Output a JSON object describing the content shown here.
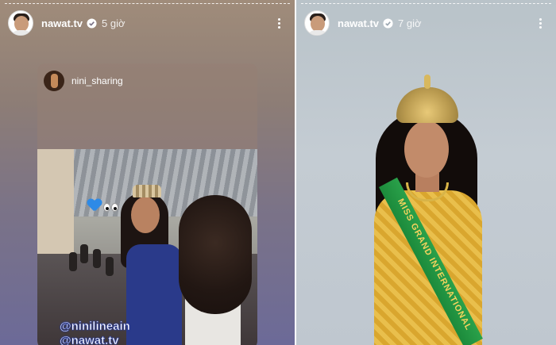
{
  "stories": [
    {
      "username": "nawat.tv",
      "time": "5 giờ",
      "icons": {
        "avatar": "profile-avatar",
        "verified": "verified-badge-icon",
        "menu": "more-options-icon"
      },
      "shared_post": {
        "username": "nini_sharing",
        "mentions": [
          "@ninilineain",
          "@nawat.tv"
        ]
      }
    },
    {
      "username": "nawat.tv",
      "time": "7 giờ",
      "icons": {
        "avatar": "profile-avatar",
        "verified": "verified-badge-icon",
        "menu": "more-options-icon"
      },
      "sash_text": "MISS GRAND INTERNATIONAL"
    }
  ],
  "colors": {
    "left_gradient_top": "#a08c7a",
    "left_gradient_bottom": "#6c6a98",
    "right_background": "#c0c8cf",
    "sash_green": "#1c8a3b",
    "dress_gold": "#d9a62e",
    "mention_stroke": "#2b3d9a"
  }
}
